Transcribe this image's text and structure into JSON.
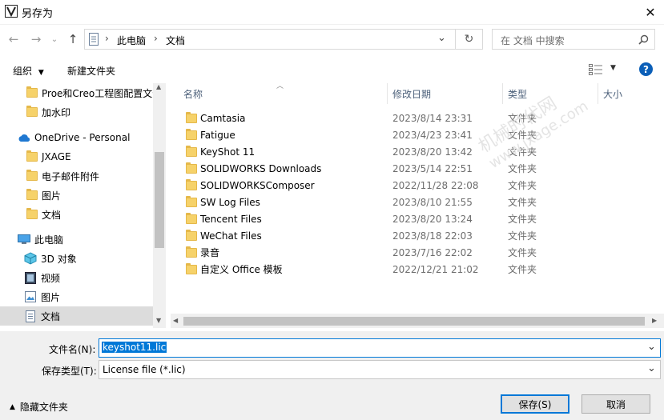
{
  "window": {
    "title": "另存为",
    "close_glyph": "✕"
  },
  "nav": {
    "back": "←",
    "forward": "→",
    "recent": "⌄",
    "up": "↑",
    "breadcrumb": [
      "此电脑",
      "文档"
    ],
    "refresh": "↻",
    "search_placeholder": "在 文档 中搜索"
  },
  "toolbar": {
    "organize": "组织",
    "new_folder": "新建文件夹",
    "help": "?"
  },
  "sidebar": {
    "items": [
      {
        "label": "Proe和Creo工程图配置文件",
        "icon": "folder-icon"
      },
      {
        "label": "加水印",
        "icon": "folder-icon"
      },
      {
        "label": "OneDrive - Personal",
        "icon": "cloud-icon"
      },
      {
        "label": "JXAGE",
        "icon": "folder-icon"
      },
      {
        "label": "电子邮件附件",
        "icon": "folder-icon"
      },
      {
        "label": "图片",
        "icon": "folder-icon"
      },
      {
        "label": "文档",
        "icon": "folder-icon"
      },
      {
        "label": "此电脑",
        "icon": "pc-icon"
      },
      {
        "label": "3D 对象",
        "icon": "cube-icon"
      },
      {
        "label": "视频",
        "icon": "video-icon"
      },
      {
        "label": "图片",
        "icon": "picture-icon"
      },
      {
        "label": "文档",
        "icon": "document-icon"
      }
    ]
  },
  "columns": {
    "name": "名称",
    "modified": "修改日期",
    "type": "类型",
    "size": "大小"
  },
  "files": [
    {
      "name": "Camtasia",
      "date": "2023/8/14 23:31",
      "type": "文件夹"
    },
    {
      "name": "Fatigue",
      "date": "2023/4/23 23:41",
      "type": "文件夹"
    },
    {
      "name": "KeyShot 11",
      "date": "2023/8/20 13:42",
      "type": "文件夹"
    },
    {
      "name": "SOLIDWORKS Downloads",
      "date": "2023/5/14 22:51",
      "type": "文件夹"
    },
    {
      "name": "SOLIDWORKSComposer",
      "date": "2022/11/28 22:08",
      "type": "文件夹"
    },
    {
      "name": "SW Log Files",
      "date": "2023/8/10 21:55",
      "type": "文件夹"
    },
    {
      "name": "Tencent Files",
      "date": "2023/8/20 13:24",
      "type": "文件夹"
    },
    {
      "name": "WeChat Files",
      "date": "2023/8/18 22:03",
      "type": "文件夹"
    },
    {
      "name": "录音",
      "date": "2023/7/16 22:02",
      "type": "文件夹"
    },
    {
      "name": "自定义 Office 模板",
      "date": "2022/12/21 21:02",
      "type": "文件夹"
    }
  ],
  "form": {
    "filename_label": "文件名(N):",
    "filename_value": "keyshot11.lic",
    "filetype_label": "保存类型(T):",
    "filetype_value": "License file (*.lic)"
  },
  "footer": {
    "hide_folders": "隐藏文件夹",
    "save": "保存(S)",
    "cancel": "取消"
  },
  "watermark": {
    "line1": "机械时代网",
    "line2": "www.jxage.com"
  },
  "colors": {
    "accent": "#0078d7",
    "header_text": "#4c607a",
    "selected_row": "#dcdcdc"
  }
}
